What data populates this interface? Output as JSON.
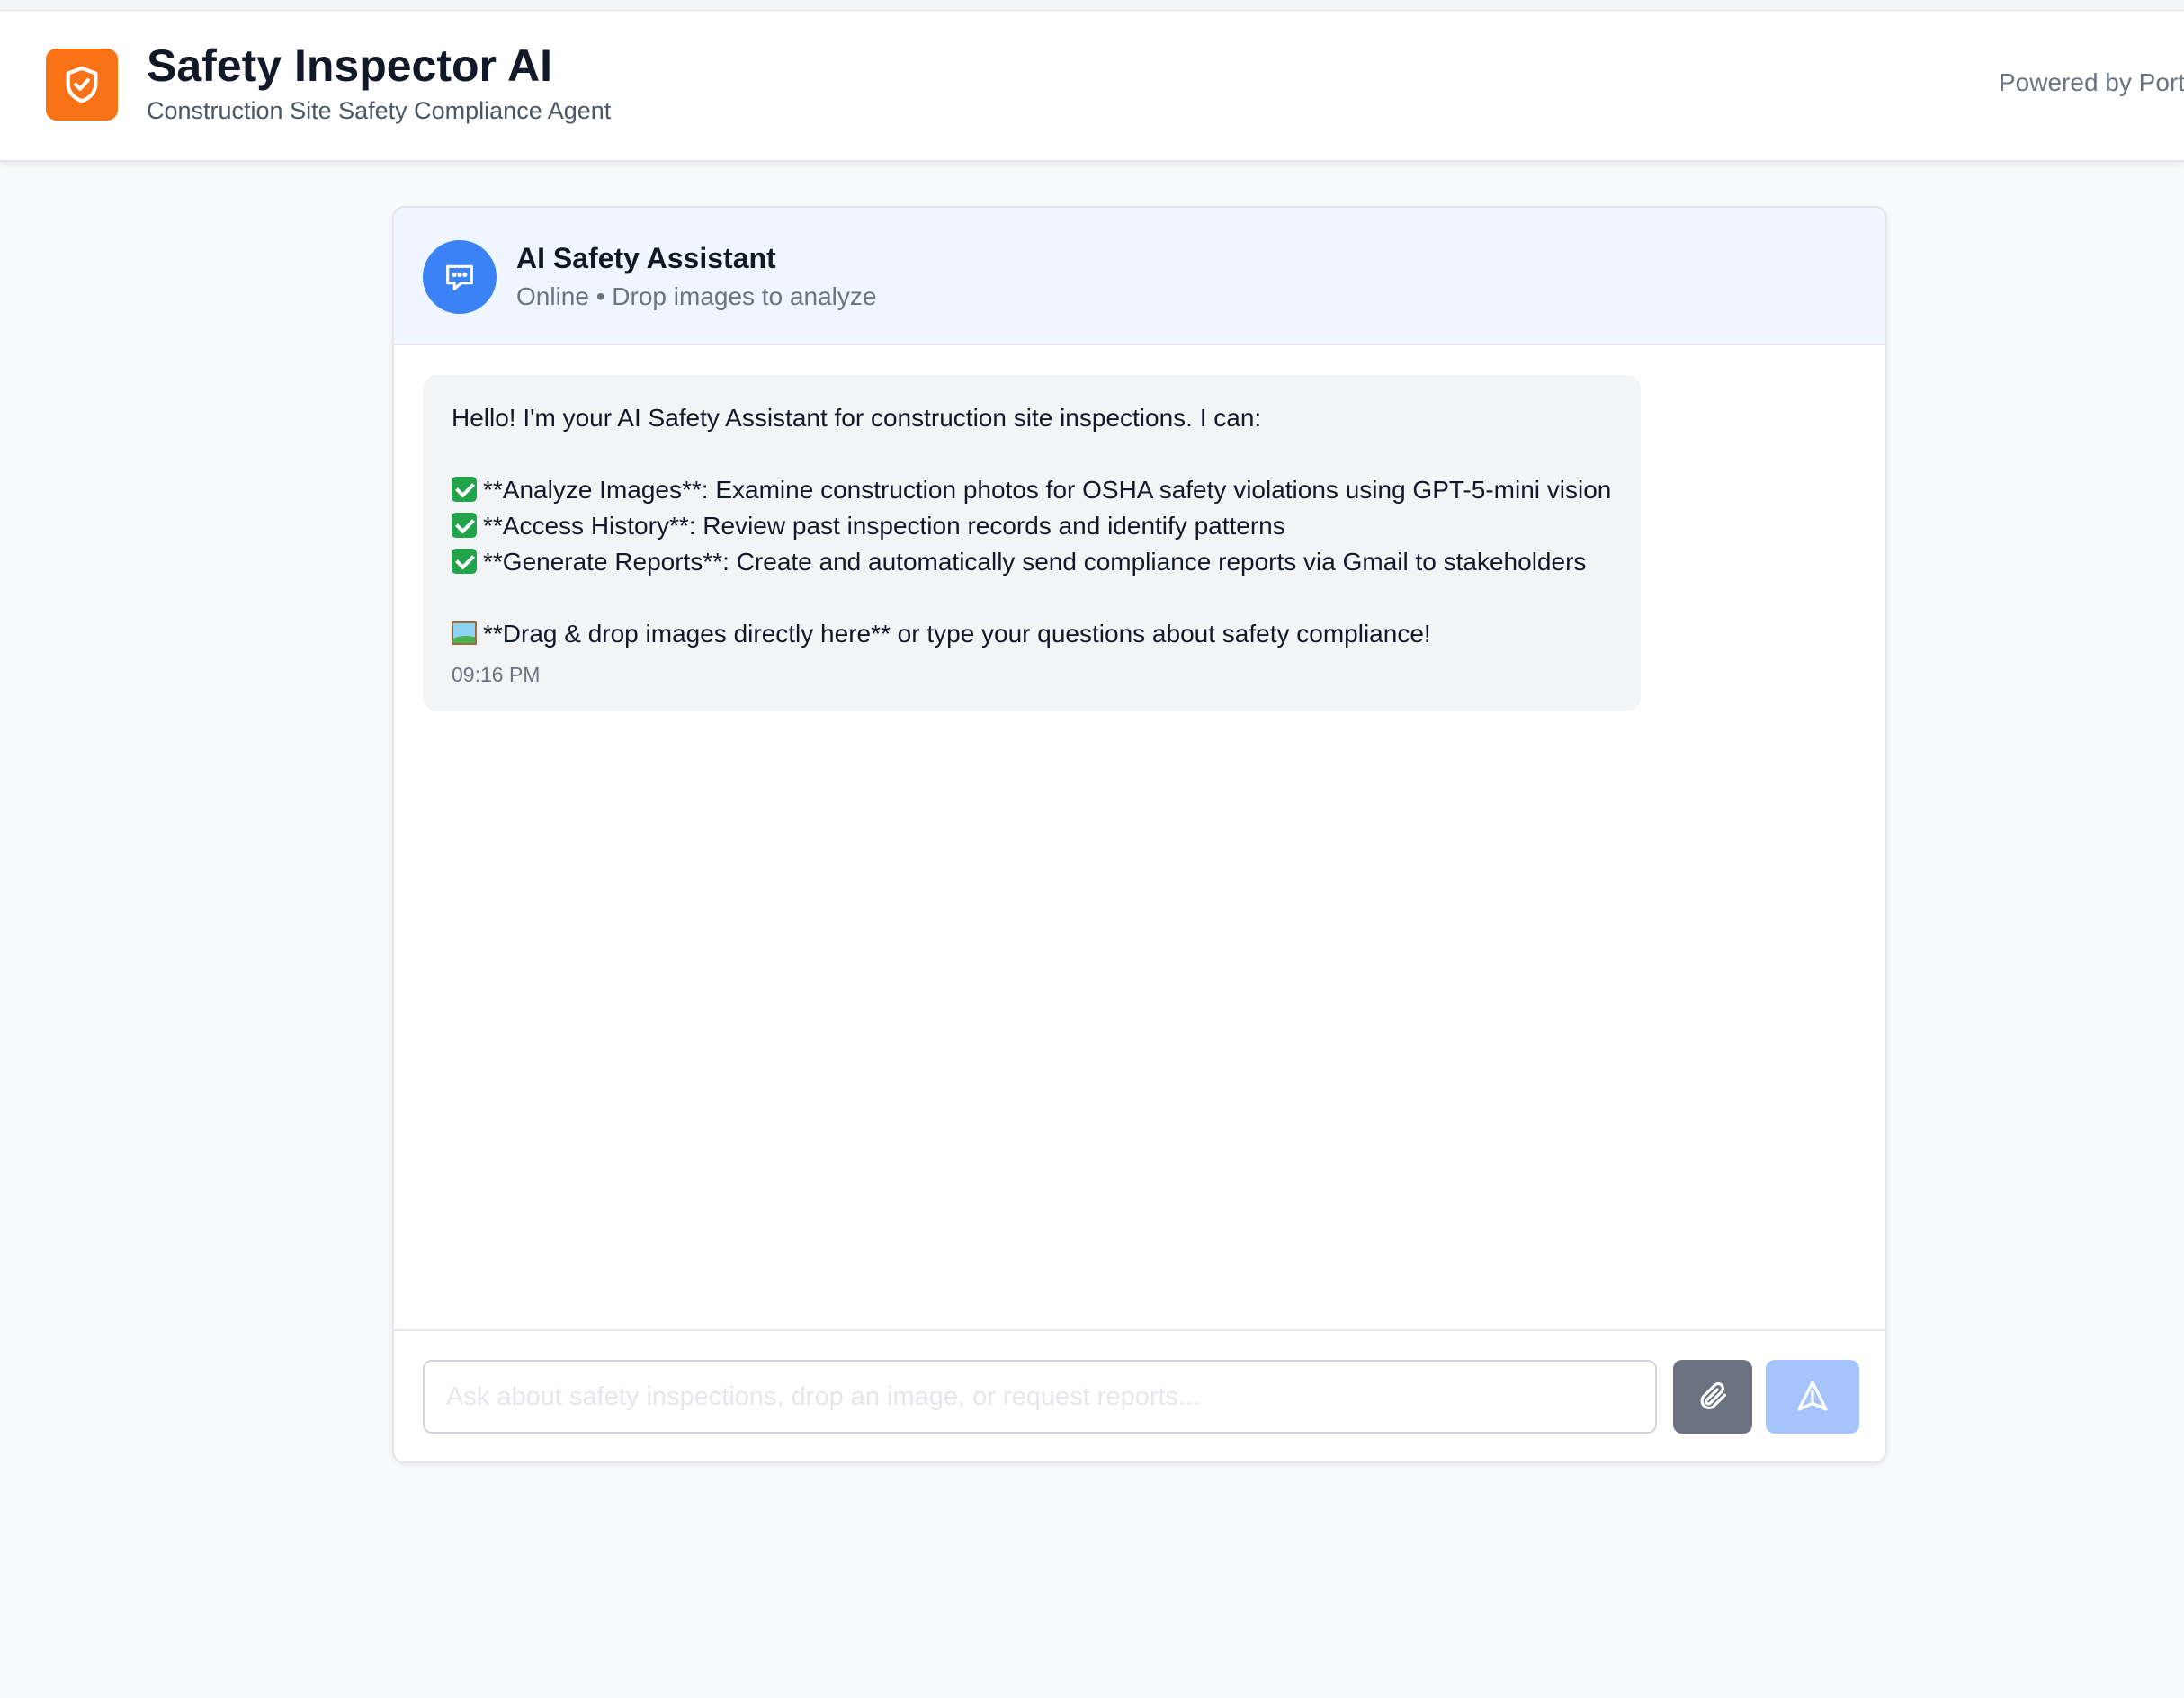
{
  "header": {
    "title": "Safety Inspector AI",
    "subtitle": "Construction Site Safety Compliance Agent",
    "powered_by": "Powered by Port",
    "logo_icon": "shield-check-icon",
    "accent_color": "#f97316"
  },
  "chat": {
    "assistant_name": "AI Safety Assistant",
    "assistant_status": "Online • Drop images to analyze",
    "avatar_icon": "chat-bubble-icon",
    "avatar_color": "#3b82f6",
    "messages": [
      {
        "sender": "assistant",
        "intro": "Hello! I'm your AI Safety Assistant for construction site inspections. I can:",
        "features": [
          "**Analyze Images**: Examine construction photos for OSHA safety violations using GPT-5-mini vision",
          "**Access History**: Review past inspection records and identify patterns",
          "**Generate Reports**: Create and automatically send compliance reports via Gmail to stakeholders"
        ],
        "closing": "**Drag & drop images directly here** or type your questions about safety compliance!",
        "time": "09:16 PM"
      }
    ]
  },
  "input": {
    "placeholder": "Ask about safety inspections, drop an image, or request reports...",
    "value": "",
    "attach_icon": "paperclip-icon",
    "send_icon": "send-icon"
  }
}
